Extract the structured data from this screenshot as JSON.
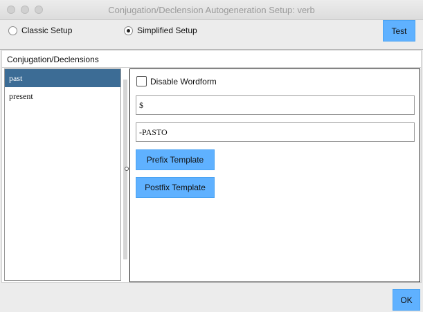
{
  "window": {
    "title": "Conjugation/Declension Autogeneration Setup: verb"
  },
  "setup_mode": {
    "options": [
      {
        "label": "Classic Setup",
        "selected": false
      },
      {
        "label": "Simplified Setup",
        "selected": true
      }
    ],
    "test_label": "Test"
  },
  "section": {
    "title": "Conjugation/Declensions"
  },
  "list": {
    "items": [
      "past",
      "present"
    ],
    "selected_index": 0
  },
  "detail": {
    "disable_label": "Disable Wordform",
    "disabled": false,
    "field1_value": "$",
    "field2_value": "-PASTO",
    "prefix_label": "Prefix Template",
    "postfix_label": "Postfix Template"
  },
  "footer": {
    "ok_label": "OK"
  },
  "colors": {
    "accent": "#5fb1ff",
    "selection": "#3c6c95"
  }
}
